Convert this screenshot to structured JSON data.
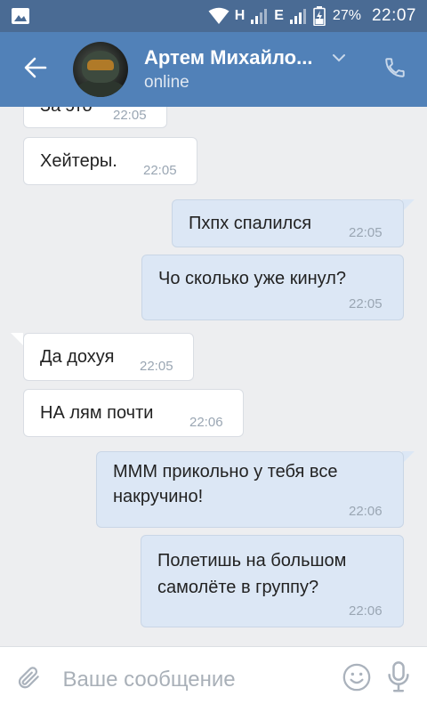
{
  "status_bar": {
    "network_1": "H",
    "network_2": "E",
    "battery": "27%",
    "time": "22:07"
  },
  "header": {
    "name": "Артем Михайло...",
    "status": "online",
    "icons": [
      "back-arrow-icon",
      "chevron-down-icon",
      "phone-icon"
    ]
  },
  "messages": [
    {
      "dir": "in",
      "text": "За это",
      "time": "22:05"
    },
    {
      "dir": "in",
      "text": "Хейтеры.",
      "time": "22:05"
    },
    {
      "dir": "out",
      "text": "Пхпх спалился",
      "time": "22:05"
    },
    {
      "dir": "out",
      "text": "Чо сколько уже кинул?",
      "time": "22:05"
    },
    {
      "dir": "in",
      "text": "Да дохуя",
      "time": "22:05"
    },
    {
      "dir": "in",
      "text": "НА лям почти",
      "time": "22:06"
    },
    {
      "dir": "out",
      "text_line1": "МММ прикольно у тебя все",
      "text_line2": "накручино!",
      "time": "22:06"
    },
    {
      "dir": "out",
      "text_line1": "Полетишь на большом",
      "text_line2": "самолёте в группу?",
      "time": "22:06"
    }
  ],
  "composer": {
    "placeholder": "Ваше сообщение",
    "icons": [
      "paperclip-icon",
      "emoji-icon",
      "microphone-icon"
    ]
  },
  "colors": {
    "status_bar": "#4a6b94",
    "header": "#5181b8",
    "background": "#edeef0",
    "incoming_bubble": "#ffffff",
    "outgoing_bubble": "#dce7f5"
  }
}
